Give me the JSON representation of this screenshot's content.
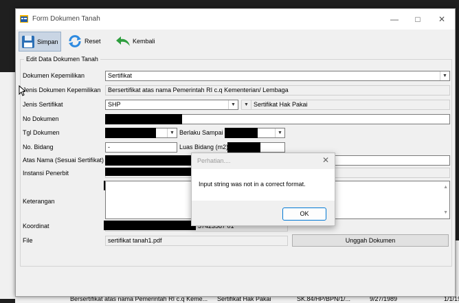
{
  "window": {
    "title": "Form Dokumen Tanah"
  },
  "toolbar": {
    "save": "Simpan",
    "reset": "Reset",
    "back": "Kembali"
  },
  "group_title": "Edit Data Dokumen Tanah",
  "labels": {
    "dokumen_kepemilikan": "Dokumen Kepemilikan",
    "jenis_dokumen": "Jenis Dokumen Kepemilikan",
    "jenis_sertifikat": "Jenis Sertifikat",
    "no_dokumen": "No Dokumen",
    "tgl_dokumen": "Tgl Dokumen",
    "berlaku_sampai": "Berlaku Sampai",
    "no_bidang": "No. Bidang",
    "luas_bidang": "Luas Bidang (m2)",
    "atas_nama": "Atas Nama (Sesuai Sertifikat)",
    "instansi": "Instansi Penerbit",
    "keterangan": "Keterangan",
    "koordinat": "Koordinat",
    "file": "File"
  },
  "values": {
    "dokumen_kepemilikan": "Sertifikat",
    "jenis_dokumen": "Bersertifikat atas nama Pemerintah RI c.q Kementerian/ Lembaga",
    "jenis_sertifikat_code": "SHP",
    "jenis_sertifikat_name": "Sertifikat Hak Pakai",
    "no_bidang": "-",
    "koordinat_tail": "57423587 01",
    "file": "sertifikat tanah1.pdf"
  },
  "buttons": {
    "upload": "Unggah Dokumen"
  },
  "dialog": {
    "title": "Perhatian....",
    "message": "Input string was not in a correct format.",
    "ok": "OK"
  },
  "background": {
    "row_doc": "Bersertifikat atas nama Pemerintah RI c.q Keme...",
    "row_type": "Sertifikat Hak Pakai",
    "row_no": "SK.84/HP/BPN/1/...",
    "row_date": "9/27/1989",
    "row_date2": "1/1/19"
  },
  "colors": {
    "accent": "#0078d4"
  }
}
